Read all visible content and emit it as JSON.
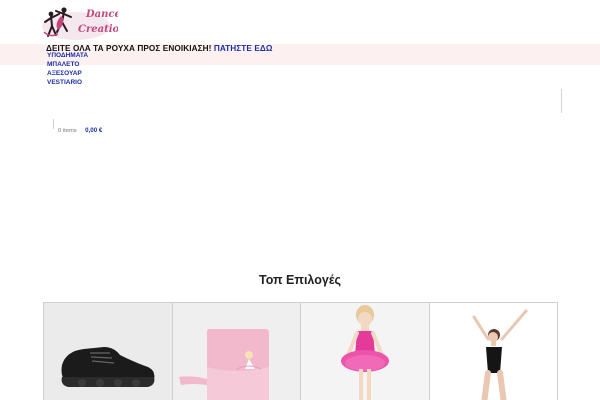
{
  "logo": {
    "alt": "Dance Creations",
    "text_line1": "Dance",
    "text_line2": "Creations"
  },
  "promo": {
    "text": "ΔΕΙΤΕ ΟΛΑ ΤΑ ΡΟΥΧΑ ΠΡΟΣ ΕΝΟΙΚΙΑΣΗ!",
    "link_label": "ΠΑΤΗΣΤΕ ΕΔΩ"
  },
  "nav": {
    "items": [
      {
        "label": "ΥΠΟΔΗΜΑΤΑ"
      },
      {
        "label": "ΜΠΑΛΕΤΟ"
      },
      {
        "label": "ΑΞΕΣΟΥΑΡ"
      },
      {
        "label": "VESTIARIO"
      }
    ]
  },
  "cart": {
    "items_label": "0 items",
    "total": "0,00 €"
  },
  "section": {
    "title": "Τοπ Επιλογές"
  },
  "products": [
    {
      "name": "black-dance-sneaker"
    },
    {
      "name": "pink-ballet-bag"
    },
    {
      "name": "pink-tutu-leotard"
    },
    {
      "name": "black-ballet-leotard"
    }
  ],
  "colors": {
    "accent": "#1a2fa8",
    "promo_bg": "#fdf0f0",
    "logo_pink": "#c5457f"
  }
}
